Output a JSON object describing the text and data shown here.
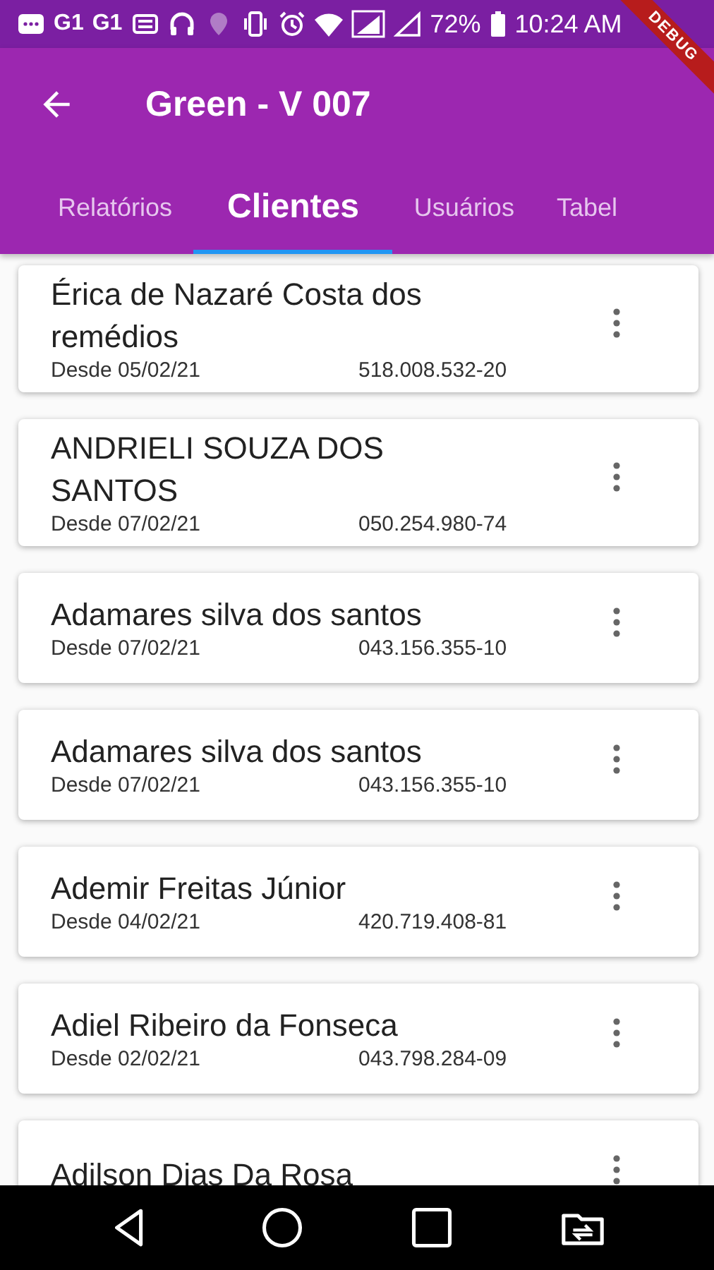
{
  "status_bar": {
    "notification_labels": [
      "G1",
      "G1"
    ],
    "battery": "72%",
    "time": "10:24 AM"
  },
  "debug_banner": "DEBUG",
  "app_bar": {
    "title": "Green - V 007"
  },
  "tabs": [
    {
      "label": "Relatórios",
      "selected": false
    },
    {
      "label": "Clientes",
      "selected": true
    },
    {
      "label": "Usuários",
      "selected": false
    },
    {
      "label": "Tabel",
      "selected": false
    }
  ],
  "clients": [
    {
      "name": " Érica de Nazaré Costa dos remédios",
      "since": "Desde 05/02/21",
      "document": "518.008.532-20"
    },
    {
      "name": "ANDRIELI SOUZA DOS SANTOS",
      "since": "Desde 07/02/21",
      "document": "050.254.980-74"
    },
    {
      "name": "Adamares silva dos santos",
      "since": "Desde 07/02/21",
      "document": "043.156.355-10"
    },
    {
      "name": "Adamares silva dos santos",
      "since": "Desde 07/02/21",
      "document": "043.156.355-10"
    },
    {
      "name": "Ademir Freitas Júnior",
      "since": "Desde 04/02/21",
      "document": "420.719.408-81"
    },
    {
      "name": "Adiel Ribeiro da Fonseca",
      "since": "Desde 02/02/21",
      "document": "043.798.284-09"
    },
    {
      "name": "Adilson Dias Da Rosa"
    }
  ]
}
